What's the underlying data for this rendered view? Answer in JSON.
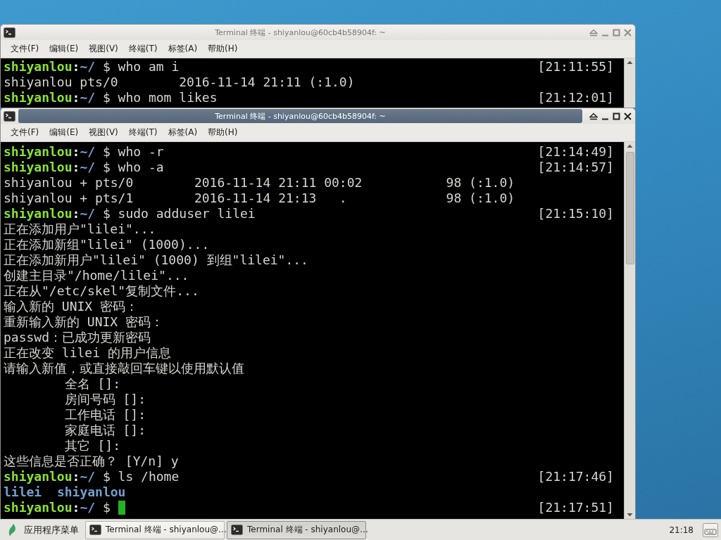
{
  "windows": [
    {
      "title": "Terminal 终端 - shiyanlou@60cb4b58904f: ~",
      "active": false,
      "menu": [
        "文件(F)",
        "编辑(E)",
        "视图(V)",
        "终端(T)",
        "标签(A)",
        "帮助(H)"
      ],
      "terminal": [
        {
          "kind": "prompt",
          "user": "shiyanlou",
          "separator": ":",
          "path": "~/",
          "symbol": "$",
          "command": "who am i",
          "time": "[21:11:55]",
          "cursor": false
        },
        {
          "kind": "output",
          "text": "shiyanlou pts/0        2016-11-14 21:11 (:1.0)"
        },
        {
          "kind": "prompt",
          "user": "shiyanlou",
          "separator": ":",
          "path": "~/",
          "symbol": "$",
          "command": "who mom likes",
          "time": "[21:12:01]",
          "cursor": false
        }
      ]
    },
    {
      "title": "Terminal 终端 - shiyanlou@60cb4b58904f: ~",
      "active": true,
      "menu": [
        "文件(F)",
        "编辑(E)",
        "视图(V)",
        "终端(T)",
        "标签(A)",
        "帮助(H)"
      ],
      "terminal": [
        {
          "kind": "prompt",
          "user": "shiyanlou",
          "separator": ":",
          "path": "~/",
          "symbol": "$",
          "command": "who -r",
          "time": "[21:14:49]",
          "cursor": false
        },
        {
          "kind": "prompt",
          "user": "shiyanlou",
          "separator": ":",
          "path": "~/",
          "symbol": "$",
          "command": "who -a",
          "time": "[21:14:57]",
          "cursor": false
        },
        {
          "kind": "output",
          "text": "shiyanlou + pts/0        2016-11-14 21:11 00:02           98 (:1.0)"
        },
        {
          "kind": "output",
          "text": "shiyanlou + pts/1        2016-11-14 21:13   .             98 (:1.0)"
        },
        {
          "kind": "prompt",
          "user": "shiyanlou",
          "separator": ":",
          "path": "~/",
          "symbol": "$",
          "command": "sudo adduser lilei",
          "time": "[21:15:10]",
          "cursor": false
        },
        {
          "kind": "output",
          "text": "正在添加用户\"lilei\"..."
        },
        {
          "kind": "output",
          "text": "正在添加新组\"lilei\" (1000)..."
        },
        {
          "kind": "output",
          "text": "正在添加新用户\"lilei\" (1000) 到组\"lilei\"..."
        },
        {
          "kind": "output",
          "text": "创建主目录\"/home/lilei\"..."
        },
        {
          "kind": "output",
          "text": "正在从\"/etc/skel\"复制文件..."
        },
        {
          "kind": "output",
          "text": "输入新的 UNIX 密码："
        },
        {
          "kind": "output",
          "text": "重新输入新的 UNIX 密码："
        },
        {
          "kind": "output",
          "text": "passwd：已成功更新密码"
        },
        {
          "kind": "output",
          "text": "正在改变 lilei 的用户信息"
        },
        {
          "kind": "output",
          "text": "请输入新值，或直接敲回车键以使用默认值"
        },
        {
          "kind": "field",
          "text": "全名 []:"
        },
        {
          "kind": "field",
          "text": "房间号码 []:"
        },
        {
          "kind": "field",
          "text": "工作电话 []:"
        },
        {
          "kind": "field",
          "text": "家庭电话 []:"
        },
        {
          "kind": "field",
          "text": "其它 []:"
        },
        {
          "kind": "output",
          "text": "这些信息是否正确？ [Y/n] y"
        },
        {
          "kind": "prompt",
          "user": "shiyanlou",
          "separator": ":",
          "path": "~/",
          "symbol": "$",
          "command": "ls /home",
          "time": "[21:17:46]",
          "cursor": false
        },
        {
          "kind": "listing",
          "entries": [
            "lilei",
            "shiyanlou"
          ]
        },
        {
          "kind": "prompt",
          "user": "shiyanlou",
          "separator": ":",
          "path": "~/",
          "symbol": "$",
          "time": "[21:17:51]",
          "cursor": true
        }
      ]
    }
  ],
  "taskbar": {
    "start_menu": "应用程序菜单",
    "tasks": [
      {
        "label": "Terminal 终端 - shiyanlou@…",
        "selected": false
      },
      {
        "label": "Terminal 终端 - shiyanlou@…",
        "selected": true
      }
    ],
    "clock": "21:18"
  }
}
